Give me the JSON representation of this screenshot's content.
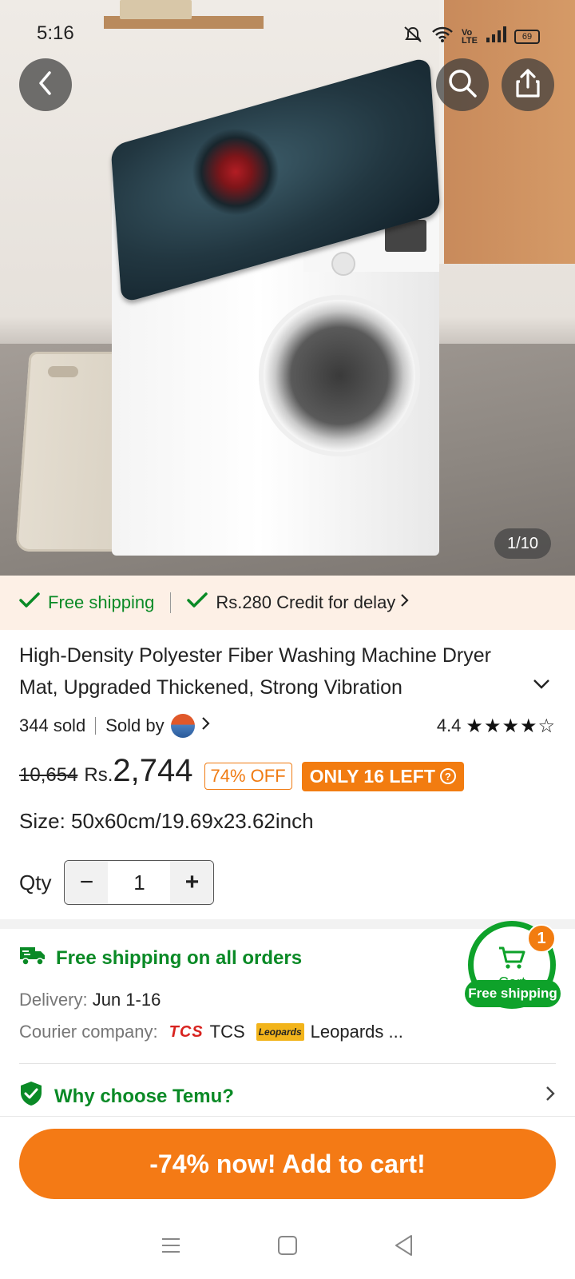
{
  "status_bar": {
    "time": "5:16",
    "battery": "69"
  },
  "gallery": {
    "counter": "1/10"
  },
  "shipping_strip": {
    "free_shipping": "Free shipping",
    "credit": "Rs.280 Credit for delay"
  },
  "product": {
    "title": "High-Density Polyester Fiber Washing Machine Dryer Mat, Upgraded Thickened, Strong Vibration",
    "sold": "344 sold",
    "sold_by": "Sold by",
    "rating": "4.4",
    "stars": "★★★★☆",
    "old_price": "10,654",
    "currency": "Rs.",
    "price": "2,744",
    "discount": "74% OFF",
    "stock": "ONLY 16 LEFT",
    "stock_help": "?",
    "size_label": "Size:",
    "size_value": "50x60cm/19.69x23.62inch",
    "qty_label": "Qty",
    "qty_value": "1",
    "qty_minus": "−",
    "qty_plus": "+"
  },
  "shipping": {
    "title": "Free shipping on all orders",
    "delivery_label": "Delivery:",
    "delivery_value": "Jun 1-16",
    "courier_label": "Courier company:",
    "tcs_logo": "TCS",
    "tcs_name": "TCS",
    "leopards_logo": "Leopards",
    "leopards_name": "Leopards ..."
  },
  "why": {
    "label": "Why choose Temu?"
  },
  "float_cart": {
    "label": "Cart",
    "badge": "1",
    "shipping": "Free shipping"
  },
  "cta": {
    "label": "-74% now! Add to cart!"
  },
  "colors": {
    "accent": "#f47a15",
    "green": "#0a8a26",
    "strip_bg": "#fdf0e6"
  }
}
